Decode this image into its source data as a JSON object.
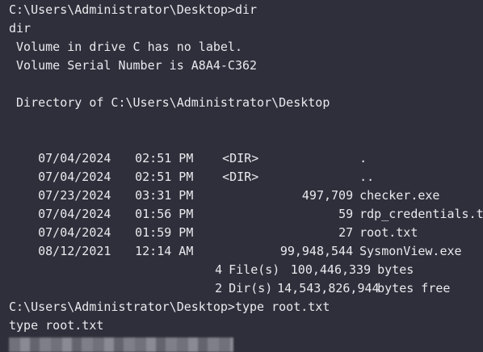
{
  "console": {
    "prompt1": "C:\\Users\\Administrator\\Desktop>dir",
    "echo1": "dir",
    "volume_label": " Volume in drive C has no label.",
    "volume_serial": " Volume Serial Number is A8A4-C362",
    "directory_of": " Directory of C:\\Users\\Administrator\\Desktop",
    "entries": [
      {
        "date": "07/04/2024",
        "time": "02:51 PM",
        "dir": "<DIR>",
        "size": "",
        "name": "."
      },
      {
        "date": "07/04/2024",
        "time": "02:51 PM",
        "dir": "<DIR>",
        "size": "",
        "name": ".."
      },
      {
        "date": "07/23/2024",
        "time": "03:31 PM",
        "dir": "",
        "size": "497,709",
        "name": "checker.exe"
      },
      {
        "date": "07/04/2024",
        "time": "01:56 PM",
        "dir": "",
        "size": "59",
        "name": "rdp_credentials.txt"
      },
      {
        "date": "07/04/2024",
        "time": "01:59 PM",
        "dir": "",
        "size": "27",
        "name": "root.txt"
      },
      {
        "date": "08/12/2021",
        "time": "12:14 AM",
        "dir": "",
        "size": "99,948,544",
        "name": "SysmonView.exe"
      }
    ],
    "summary": [
      {
        "count": "4",
        "kind": "File(s)",
        "num": "100,446,339",
        "unit": "bytes"
      },
      {
        "count": "2",
        "kind": "Dir(s)",
        "num": "14,543,826,944",
        "unit": "bytes free"
      }
    ],
    "prompt2": "C:\\Users\\Administrator\\Desktop>type root.txt",
    "echo2": "type root.txt"
  }
}
